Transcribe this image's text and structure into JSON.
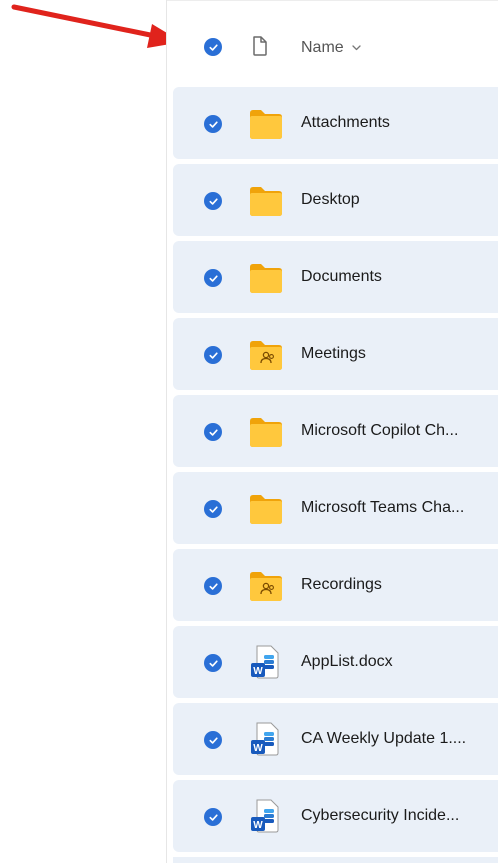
{
  "header": {
    "name_label": "Name",
    "sort_icon": "chevron-down-icon"
  },
  "colors": {
    "accent": "#2a6fd6",
    "row_selected_bg": "#eaf0f8",
    "folder": "#ffc83d",
    "arrow": "#e0231c",
    "word": "#185abd"
  },
  "rows": [
    {
      "name": "Attachments",
      "type": "folder"
    },
    {
      "name": "Desktop",
      "type": "folder"
    },
    {
      "name": "Documents",
      "type": "folder"
    },
    {
      "name": "Meetings",
      "type": "shared-folder"
    },
    {
      "name": "Microsoft Copilot Ch...",
      "type": "folder"
    },
    {
      "name": "Microsoft Teams Cha...",
      "type": "folder"
    },
    {
      "name": "Recordings",
      "type": "shared-folder"
    },
    {
      "name": "AppList.docx",
      "type": "word-document"
    },
    {
      "name": "CA Weekly Update 1....",
      "type": "word-document"
    },
    {
      "name": "Cybersecurity Incide...",
      "type": "word-document"
    }
  ]
}
